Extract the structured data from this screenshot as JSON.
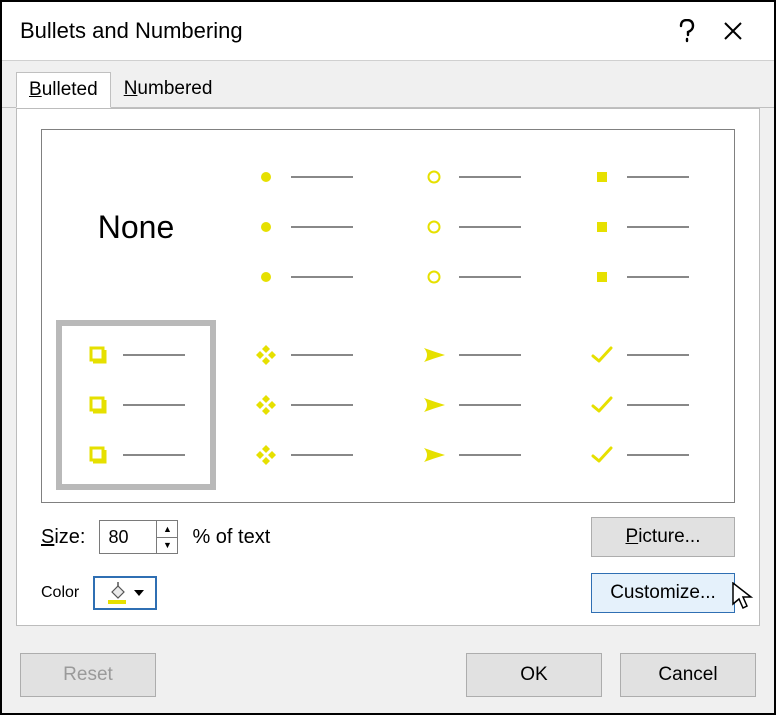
{
  "dialog": {
    "title": "Bullets and Numbering"
  },
  "tabs": {
    "bulleted": "Bulleted",
    "numbered": "Numbered"
  },
  "grid": {
    "none": "None"
  },
  "size": {
    "label": "Size:",
    "value": "80",
    "suffix": "% of text"
  },
  "color": {
    "label": "Color"
  },
  "buttons": {
    "picture": "Picture...",
    "customize": "Customize...",
    "reset": "Reset",
    "ok": "OK",
    "cancel": "Cancel"
  },
  "accent": "#e6e000"
}
